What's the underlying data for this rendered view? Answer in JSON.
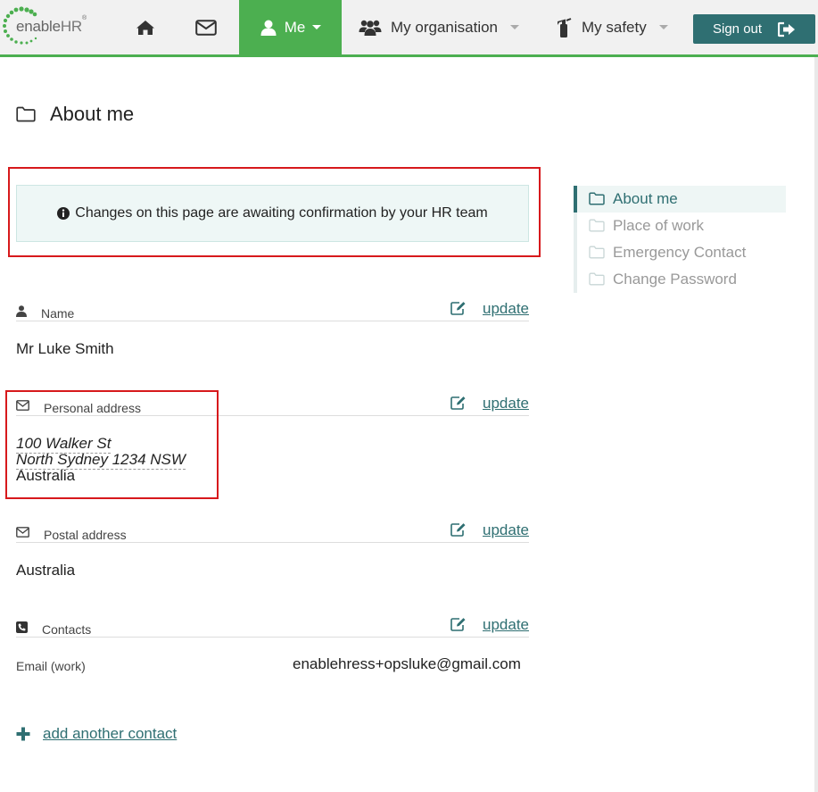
{
  "brand": {
    "logo_text_1": "enable",
    "logo_text_2": "HR",
    "logo_mark": "®"
  },
  "nav": {
    "home_icon": "home-icon",
    "mail_icon": "envelope-icon",
    "me_label": "Me",
    "organisation_label": "My organisation",
    "safety_label": "My safety",
    "signout_label": "Sign out"
  },
  "page": {
    "title": "About me",
    "notice": "Changes on this page are awaiting confirmation by your HR team"
  },
  "sections": {
    "name": {
      "title": "Name",
      "update": "update",
      "value": "Mr Luke Smith"
    },
    "personal_address": {
      "title": "Personal address",
      "update": "update",
      "line1": "100 Walker St",
      "line2": "North Sydney 1234 NSW",
      "line3": "Australia"
    },
    "postal_address": {
      "title": "Postal address",
      "update": "update",
      "value": "Australia"
    },
    "contacts": {
      "title": "Contacts",
      "update": "update",
      "items": [
        {
          "label": "Email (work)",
          "value": "enablehress+opsluke@gmail.com"
        }
      ],
      "add_label": "add another contact"
    }
  },
  "sidenav": {
    "items": [
      {
        "label": "About me",
        "active": true
      },
      {
        "label": "Place of work",
        "active": false
      },
      {
        "label": "Emergency Contact",
        "active": false
      },
      {
        "label": "Change Password",
        "active": false
      }
    ]
  },
  "colors": {
    "accent": "#4caf50",
    "teal": "#2f6f72",
    "highlight": "#d7191c"
  }
}
